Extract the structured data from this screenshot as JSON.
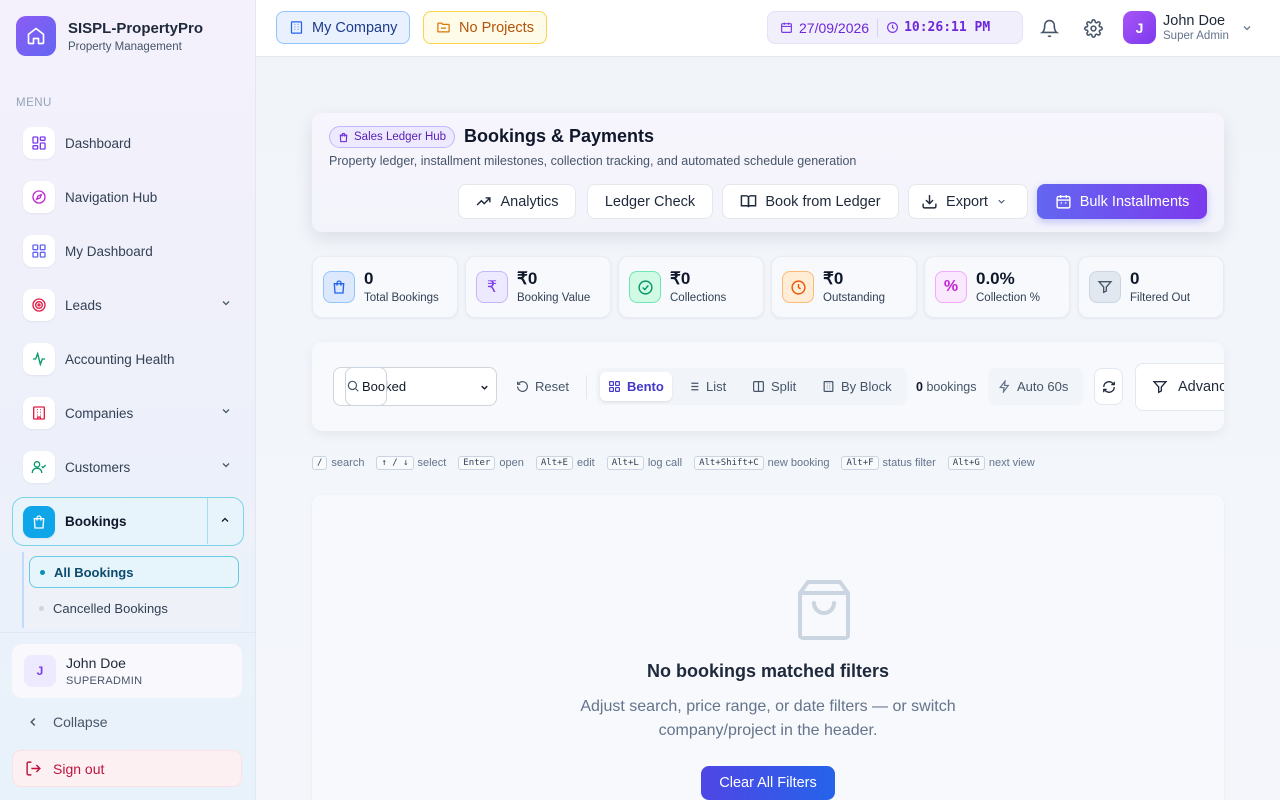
{
  "brand": {
    "title": "SISPL-PropertyPro",
    "subtitle": "Property Management"
  },
  "sidebar": {
    "menu_label": "MENU",
    "items": [
      {
        "label": "Dashboard",
        "icon": "grid-icon"
      },
      {
        "label": "Navigation Hub",
        "icon": "compass-icon"
      },
      {
        "label": "My Dashboard",
        "icon": "grid-icon"
      },
      {
        "label": "Leads",
        "icon": "target-icon"
      },
      {
        "label": "Accounting Health",
        "icon": "activity-icon"
      },
      {
        "label": "Companies",
        "icon": "building-icon"
      },
      {
        "label": "Customers",
        "icon": "user-check-icon"
      },
      {
        "label": "Bookings",
        "icon": "shopping-bag-icon"
      }
    ],
    "bookings_sub": [
      {
        "label": "All Bookings"
      },
      {
        "label": "Cancelled Bookings"
      }
    ],
    "user": {
      "initial": "J",
      "name": "John Doe",
      "role": "SUPERADMIN"
    },
    "collapse_label": "Collapse",
    "signout_label": "Sign out"
  },
  "header": {
    "company": "My Company",
    "project": "No Projects",
    "date": "27/09/2026",
    "time": "10:26:11 PM",
    "user": {
      "initial": "J",
      "name": "John Doe",
      "role": "Super Admin"
    }
  },
  "hero": {
    "badge": "Sales Ledger Hub",
    "title": "Bookings & Payments",
    "subtitle": "Property ledger, installment milestones, collection tracking, and automated schedule generation",
    "buttons": {
      "analytics": "Analytics",
      "ledger_check": "Ledger Check",
      "book_from_ledger": "Book from Ledger",
      "export": "Export",
      "bulk": "Bulk Installments"
    }
  },
  "stats": [
    {
      "value": "0",
      "label": "Total Bookings",
      "color": "#3b82f6"
    },
    {
      "value": "₹0",
      "label": "Booking Value",
      "color": "#7c3aed"
    },
    {
      "value": "₹0",
      "label": "Collections",
      "color": "#059669"
    },
    {
      "value": "₹0",
      "label": "Outstanding",
      "color": "#ea580c"
    },
    {
      "value": "0.0%",
      "label": "Collection %",
      "color": "#c026d3"
    },
    {
      "value": "0",
      "label": "Filtered Out",
      "color": "#475569"
    }
  ],
  "toolbar": {
    "status_value": "Booked",
    "reset": "Reset",
    "views": [
      "Bento",
      "List",
      "Split",
      "By Block"
    ],
    "count": "0",
    "count_suffix": "bookings",
    "auto": "Auto 60s",
    "advanced": "Advanc"
  },
  "shortcuts": [
    {
      "key": "/",
      "label": "search"
    },
    {
      "key": "↑ / ↓",
      "label": "select"
    },
    {
      "key": "Enter",
      "label": "open"
    },
    {
      "key": "Alt+E",
      "label": "edit"
    },
    {
      "key": "Alt+L",
      "label": "log call"
    },
    {
      "key": "Alt+Shift+C",
      "label": "new booking"
    },
    {
      "key": "Alt+F",
      "label": "status filter"
    },
    {
      "key": "Alt+G",
      "label": "next view"
    }
  ],
  "empty": {
    "title": "No bookings matched filters",
    "description": "Adjust search, price range, or date filters — or switch company/project in the header.",
    "button": "Clear All Filters"
  }
}
